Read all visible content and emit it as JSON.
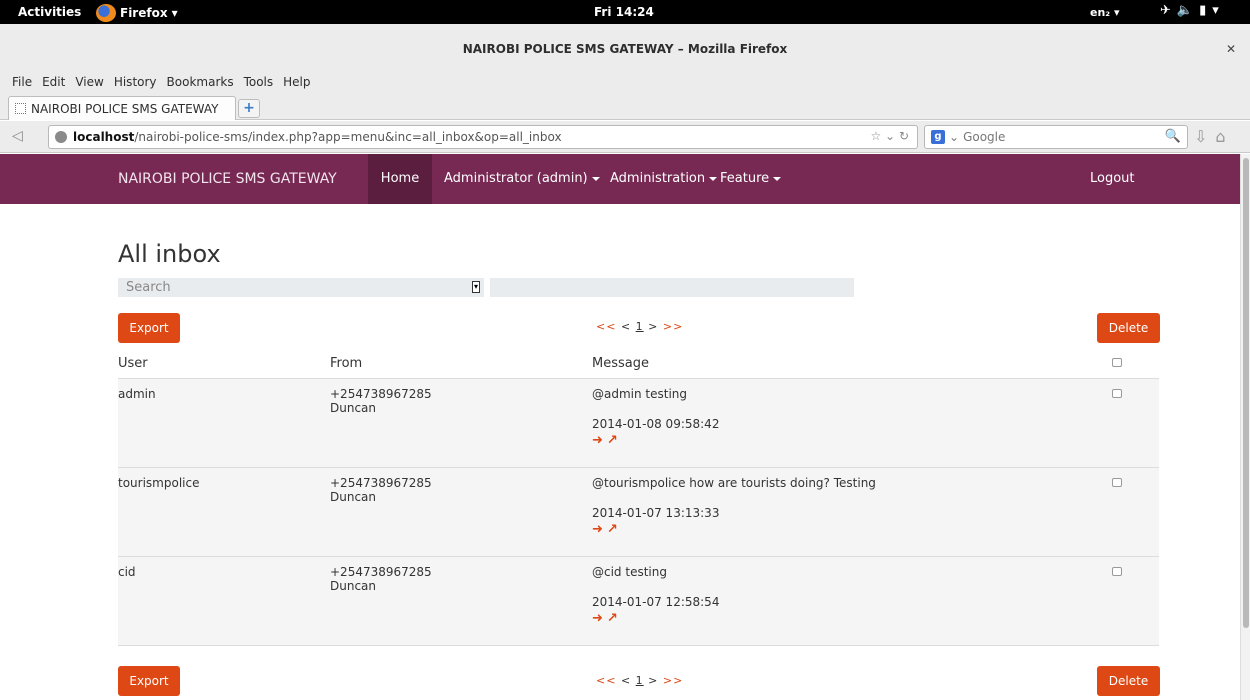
{
  "desktop": {
    "activities": "Activities",
    "app_menu": "Firefox",
    "clock": "Fri 14:24",
    "lang": "en₂"
  },
  "browser": {
    "window_title": "NAIROBI POLICE SMS GATEWAY – Mozilla Firefox",
    "menu": [
      "File",
      "Edit",
      "View",
      "History",
      "Bookmarks",
      "Tools",
      "Help"
    ],
    "tab_title": "NAIROBI POLICE SMS GATEWAY",
    "url_host": "localhost",
    "url_path": "/nairobi-police-sms/index.php?app=menu&inc=all_inbox&op=all_inbox",
    "search_placeholder": "Google"
  },
  "app": {
    "brand": "NAIROBI POLICE SMS GATEWAY",
    "nav": {
      "home": "Home",
      "admin": "Administrator (admin)",
      "administration": "Administration",
      "feature": "Feature",
      "logout": "Logout"
    },
    "heading": "All inbox",
    "search_select": "Search",
    "export_label": "Export",
    "delete_label": "Delete",
    "pager": {
      "first": "<<",
      "prev": "<",
      "page": "1",
      "next": ">",
      "last": ">>"
    },
    "columns": {
      "user": "User",
      "from": "From",
      "message": "Message"
    },
    "rows": [
      {
        "user": "admin",
        "from_number": "+254738967285",
        "from_name": "Duncan",
        "message": "@admin testing",
        "datetime": "2014-01-08 09:58:42"
      },
      {
        "user": "tourismpolice",
        "from_number": "+254738967285",
        "from_name": "Duncan",
        "message": "@tourismpolice how are tourists doing? Testing",
        "datetime": "2014-01-07 13:13:33"
      },
      {
        "user": "cid",
        "from_number": "+254738967285",
        "from_name": "Duncan",
        "message": "@cid testing",
        "datetime": "2014-01-07 12:58:54"
      }
    ]
  },
  "colors": {
    "navbar": "#772953",
    "accent": "#dd4814"
  }
}
